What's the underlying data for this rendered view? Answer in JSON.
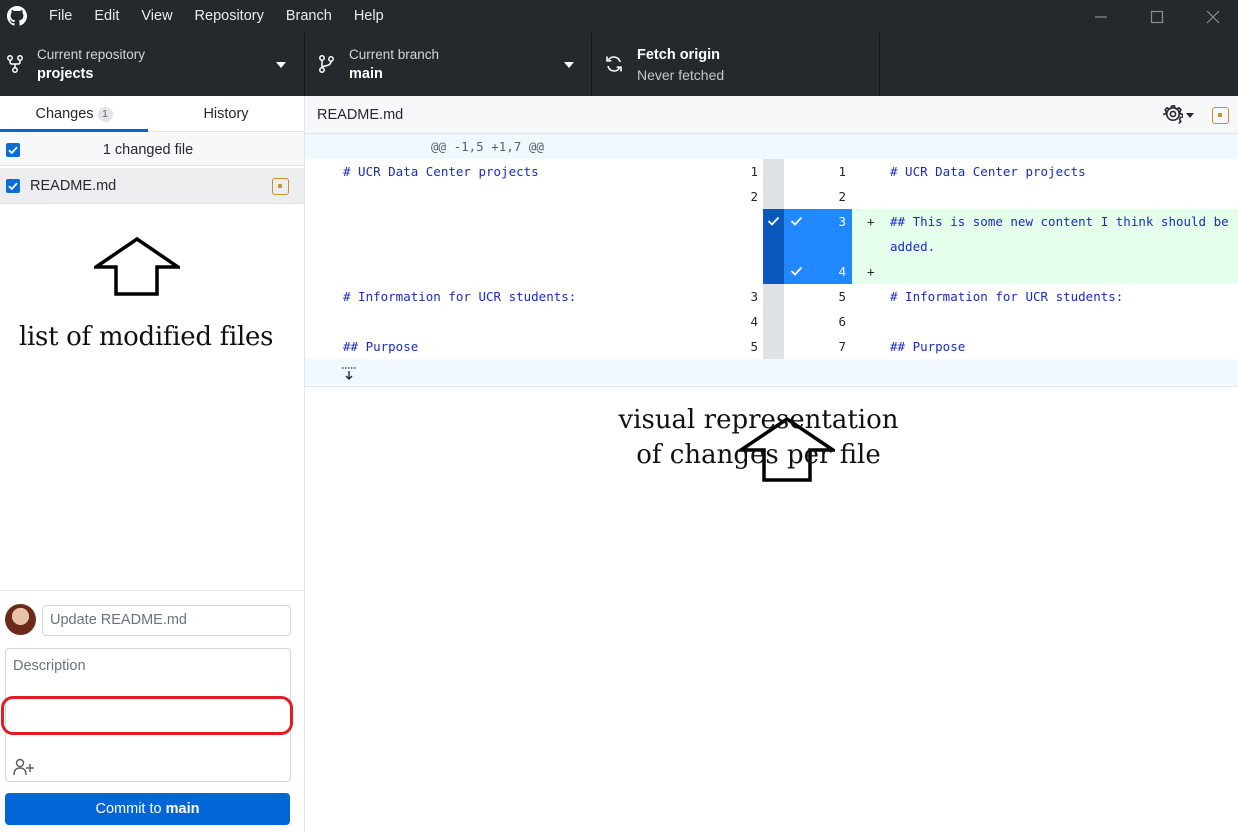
{
  "menu": [
    "File",
    "Edit",
    "View",
    "Repository",
    "Branch",
    "Help"
  ],
  "toolbar": {
    "repo_label": "Current repository",
    "repo_value": "projects",
    "branch_label": "Current branch",
    "branch_value": "main",
    "fetch_label": "Fetch origin",
    "fetch_status": "Never fetched"
  },
  "sidebar": {
    "tabs": [
      {
        "label": "Changes",
        "badge": "1"
      },
      {
        "label": "History"
      }
    ],
    "changed_summary": "1 changed file",
    "files": [
      {
        "name": "README.md",
        "status": "modified"
      }
    ]
  },
  "commit": {
    "summary_placeholder": "Update README.md",
    "description_placeholder": "Description",
    "button_prefix": "Commit to",
    "button_branch": "main"
  },
  "diff": {
    "file_title": "README.md",
    "hunk_header": "@@ -1,5 +1,7 @@",
    "rows": [
      {
        "left_text": "# UCR Data Center projects",
        "left_no": "1",
        "right_no": "1",
        "right_text": "# UCR Data Center projects"
      },
      {
        "left_text": "",
        "left_no": "2",
        "right_no": "2",
        "right_text": ""
      },
      {
        "left_text": "",
        "left_no": "",
        "right_no": "3",
        "marker": "+",
        "right_text": "## This is some new content I think should be"
      },
      {
        "left_text": "",
        "left_no": "",
        "right_no": "",
        "right_text": "added."
      },
      {
        "left_text": "",
        "left_no": "",
        "right_no": "4",
        "marker": "+",
        "right_text": ""
      },
      {
        "left_text": "# Information for UCR students:",
        "left_no": "3",
        "right_no": "5",
        "right_text": "# Information for UCR students:"
      },
      {
        "left_text": "",
        "left_no": "4",
        "right_no": "6",
        "right_text": ""
      },
      {
        "left_text": "## Purpose",
        "left_no": "5",
        "right_no": "7",
        "right_text": "## Purpose"
      }
    ]
  },
  "annotations": {
    "left": "list of modified files",
    "right_line1": "visual representation",
    "right_line2": "of changes per file"
  },
  "colors": {
    "chrome": "#24292e",
    "accent": "#0366d6",
    "added_bg": "#e6ffed",
    "modified": "#c6912b",
    "highlight_ring": "#e21b25"
  }
}
